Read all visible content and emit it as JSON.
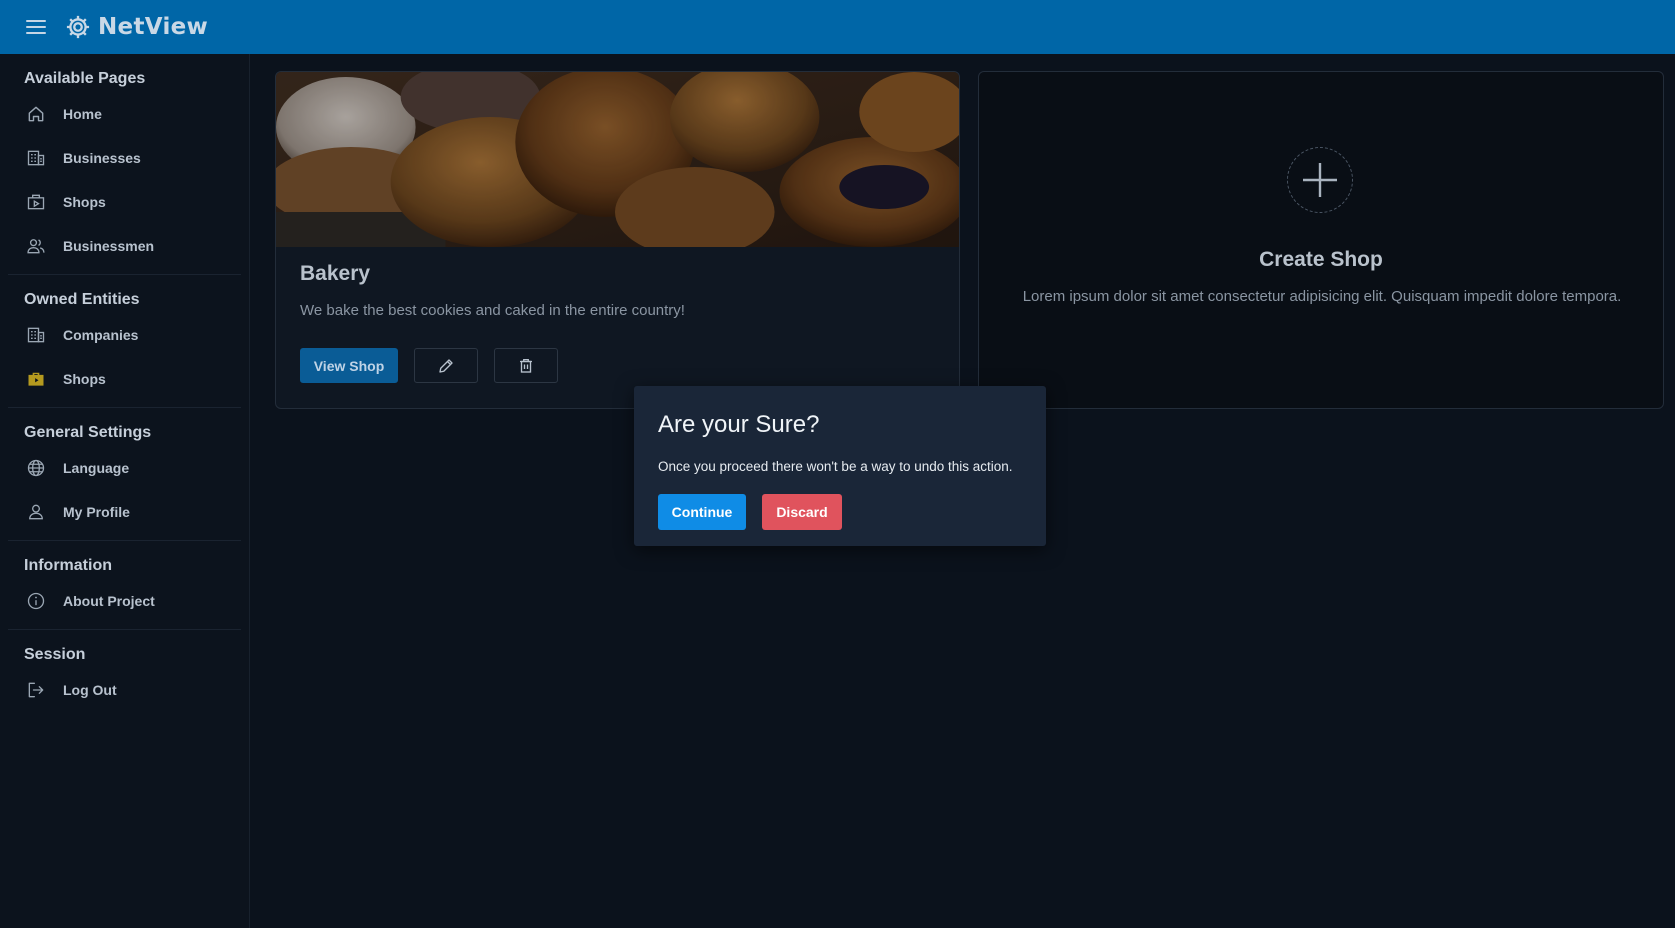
{
  "header": {
    "app_name": "NetView",
    "menu_icon": "hamburger-menu-icon",
    "logo_icon": "gear-logo-icon",
    "background": "#0066a7"
  },
  "sidebar": {
    "sections": [
      {
        "heading": "Available Pages",
        "items": [
          {
            "label": "Home",
            "icon": "home-icon"
          },
          {
            "label": "Businesses",
            "icon": "building-icon"
          },
          {
            "label": "Shops",
            "icon": "shop-icon"
          },
          {
            "label": "Businessmen",
            "icon": "users-icon"
          }
        ]
      },
      {
        "heading": "Owned Entities",
        "items": [
          {
            "label": "Companies",
            "icon": "building-icon"
          },
          {
            "label": "Shops",
            "icon": "briefcase-icon",
            "icon_color": "#b59a1f"
          }
        ]
      },
      {
        "heading": "General Settings",
        "items": [
          {
            "label": "Language",
            "icon": "globe-icon"
          },
          {
            "label": "My Profile",
            "icon": "user-icon"
          }
        ]
      },
      {
        "heading": "Information",
        "items": [
          {
            "label": "About Project",
            "icon": "info-icon"
          }
        ]
      },
      {
        "heading": "Session",
        "items": [
          {
            "label": "Log Out",
            "icon": "logout-icon"
          }
        ]
      }
    ]
  },
  "shop_card": {
    "title": "Bakery",
    "description": "We bake the best cookies and caked in the entire country!",
    "view_label": "View Shop",
    "edit_icon": "pencil-icon",
    "delete_icon": "trash-icon"
  },
  "create_card": {
    "icon": "plus-icon",
    "title": "Create Shop",
    "description": "Lorem ipsum dolor sit amet consectetur adipisicing elit. Quisquam impedit dolore tempora."
  },
  "modal": {
    "title": "Are your Sure?",
    "message": "Once you proceed there won't be a way to undo this action.",
    "continue_label": "Continue",
    "discard_label": "Discard",
    "continue_color": "#0f8ce6",
    "discard_color": "#e0535d"
  }
}
